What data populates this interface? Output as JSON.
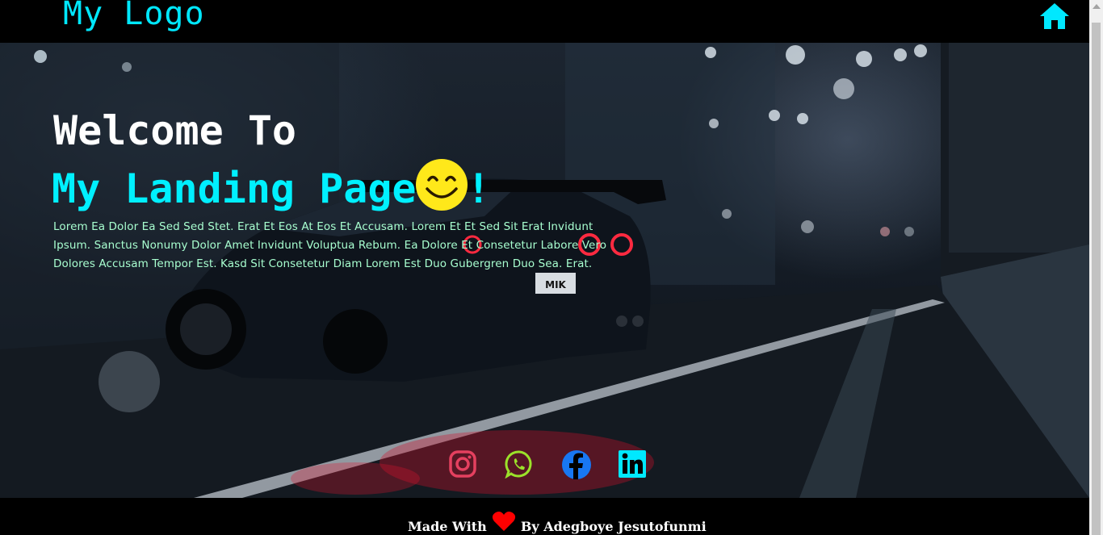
{
  "header": {
    "logo": "My Logo",
    "home_icon": "home-icon"
  },
  "hero": {
    "welcome": "Welcome To",
    "landing": "My Landing Page",
    "exclaim": "!",
    "emoji": "smiling-face-icon",
    "body": "Lorem Ea Dolor Ea Sed Sed Stet. Erat Et Eos At Eos Et Accusam. Lorem Et Et Sed Sit Erat Invidunt Ipsum. Sanctus Nonumy Dolor Amet Invidunt Voluptua Rebum. Ea Dolore Et Consetetur Labore Vero Dolores Accusam Tempor Est. Kasd Sit Consetetur Diam Lorem Est Duo Gubergren Duo Sea. Erat.",
    "plate": "MIK"
  },
  "socials": [
    {
      "name": "instagram-icon",
      "color": "#e4405f"
    },
    {
      "name": "whatsapp-icon",
      "color": "#9be22a"
    },
    {
      "name": "facebook-icon",
      "color": "#1877f2"
    },
    {
      "name": "linkedin-icon",
      "color": "#00e8ff"
    }
  ],
  "footer": {
    "made_with": "Made With",
    "by": "By Adegboye Jesutofunmi",
    "heart_color": "#ff0000"
  },
  "colors": {
    "accent": "#00e8ff",
    "body_text": "#a8ffd0"
  }
}
